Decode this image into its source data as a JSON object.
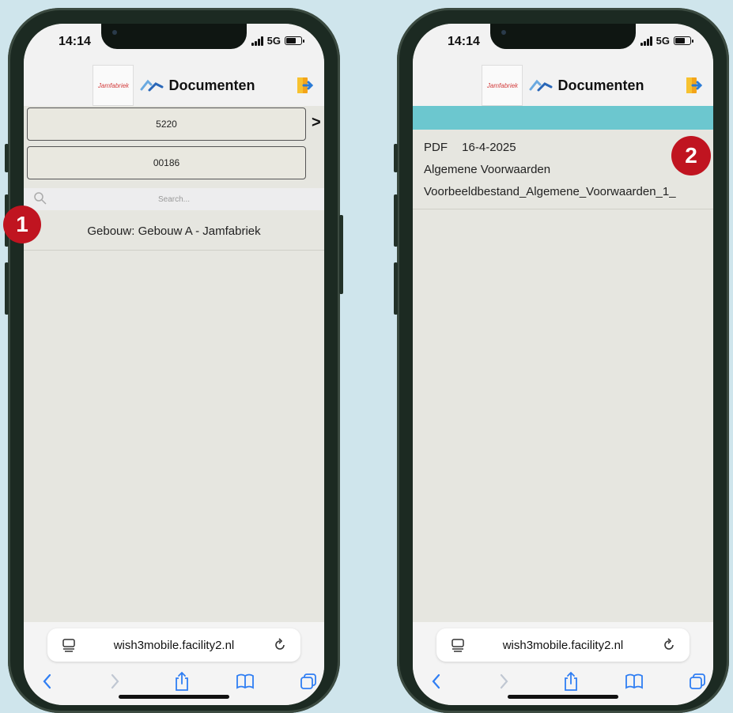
{
  "badges": [
    "1",
    "2"
  ],
  "screens": [
    {
      "status": {
        "time": "14:14",
        "network": "5G"
      },
      "header": {
        "logo_text": "Jamfabriek",
        "title": "Documenten"
      },
      "fields": [
        "5220",
        "00186"
      ],
      "search_placeholder": "Search...",
      "rows": [
        "Gebouw: Gebouw A - Jamfabriek"
      ],
      "url": "wish3mobile.facility2.nl"
    },
    {
      "status": {
        "time": "14:14",
        "network": "5G"
      },
      "header": {
        "logo_text": "Jamfabriek",
        "title": "Documenten"
      },
      "document": {
        "type": "PDF",
        "date": "16-4-2025",
        "name": "Algemene Voorwaarden",
        "file": "Voorbeeldbestand_Algemene_Voorwaarden_1_"
      },
      "url": "wish3mobile.facility2.nl"
    }
  ],
  "colors": {
    "accent_teal": "#6cc7cf",
    "badge_red": "#c01420",
    "background": "#cfe5ec"
  },
  "icons": [
    "brand-icon",
    "exit-icon",
    "search-icon",
    "reader-icon",
    "reload-icon",
    "back-icon",
    "forward-icon",
    "share-icon",
    "bookmarks-icon",
    "tabs-icon"
  ]
}
